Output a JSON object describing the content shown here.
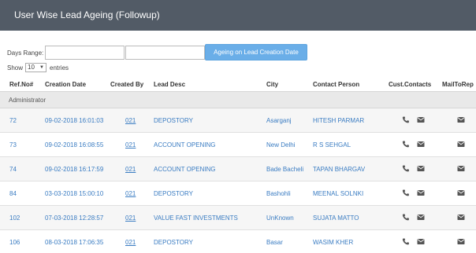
{
  "header": {
    "title": "User Wise Lead Ageing (Followup)"
  },
  "filters": {
    "days_range_label": "Days Range:",
    "from_value": "",
    "to_value": "",
    "ageing_button": "Ageing on Lead Creation Date"
  },
  "paging": {
    "show_label": "Show",
    "entries_value": "10",
    "entries_label": "entries"
  },
  "table": {
    "columns": [
      "Ref.No#",
      "Creation Date",
      "Created By",
      "Lead Desc",
      "City",
      "Contact Person",
      "Cust.Contacts",
      "MailToRep"
    ],
    "group": "Administrator",
    "rows": [
      {
        "ref": "72",
        "date": "09-02-2018 16:01:03",
        "by": "021",
        "desc": "DEPOSTORY",
        "city": "Asarganj",
        "person": "HITESH PARMAR"
      },
      {
        "ref": "73",
        "date": "09-02-2018 16:08:55",
        "by": "021",
        "desc": "ACCOUNT OPENING",
        "city": "New Delhi",
        "person": "R S SEHGAL"
      },
      {
        "ref": "74",
        "date": "09-02-2018 16:17:59",
        "by": "021",
        "desc": "ACCOUNT OPENING",
        "city": "Bade Bacheli",
        "person": "TAPAN BHARGAV"
      },
      {
        "ref": "84",
        "date": "03-03-2018 15:00:10",
        "by": "021",
        "desc": "DEPOSTORY",
        "city": "Bashohli",
        "person": "MEENAL SOLNKI"
      },
      {
        "ref": "102",
        "date": "07-03-2018 12:28:57",
        "by": "021",
        "desc": "VALUE FAST INVESTMENTS",
        "city": "UnKnown",
        "person": "SUJATA MATTO"
      },
      {
        "ref": "106",
        "date": "08-03-2018 17:06:35",
        "by": "021",
        "desc": "DEPOSTORY",
        "city": "Basar",
        "person": "WASIM KHER"
      }
    ]
  },
  "icons": {
    "phone": "phone-icon",
    "mail": "mail-icon"
  },
  "colors": {
    "header_bg": "#525b66",
    "accent": "#6aaee8",
    "link": "#3a7cc2",
    "group_bg": "#e9e9e9"
  }
}
